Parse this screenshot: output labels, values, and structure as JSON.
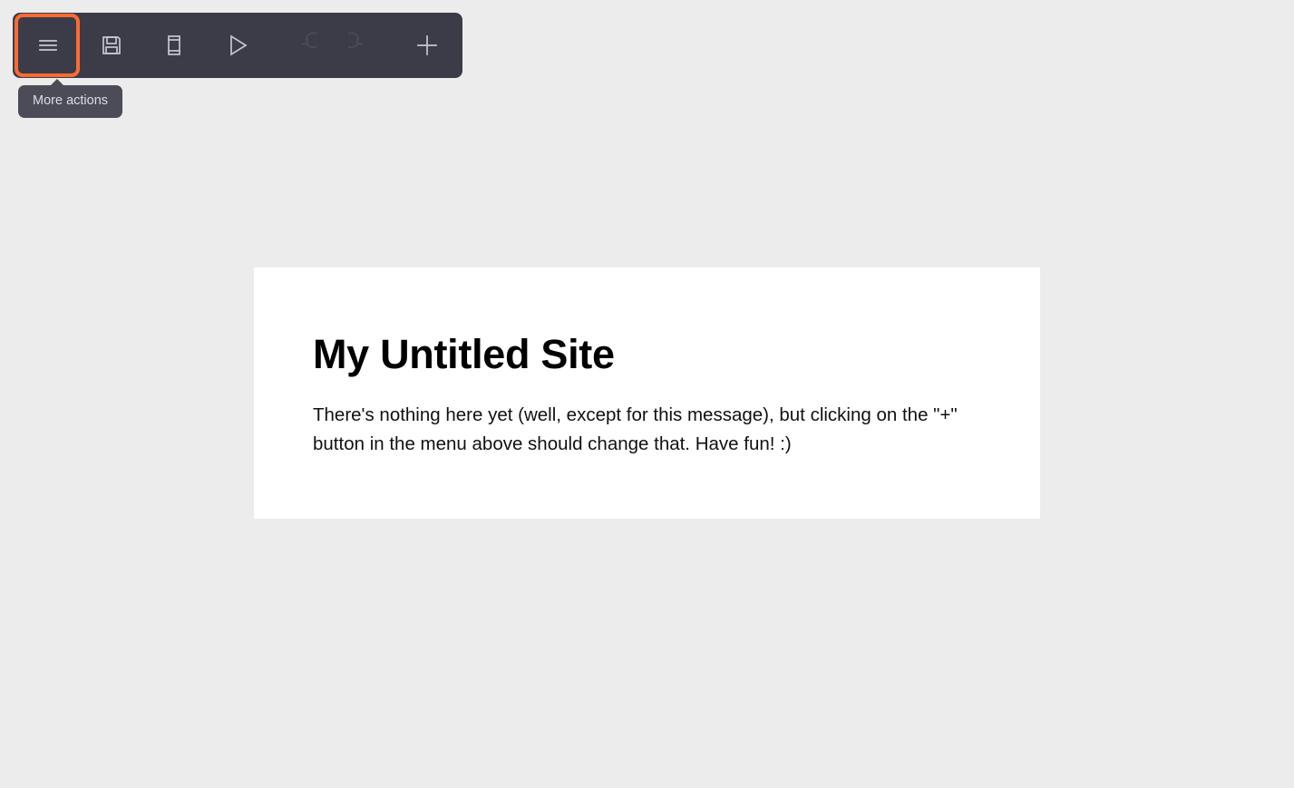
{
  "toolbar": {
    "background_color": "#3b3c48",
    "icon_color": "#c5c7d0",
    "disabled_icon_color": "#4b4c58",
    "buttons": [
      {
        "name": "more-actions",
        "icon": "hamburger-menu-icon",
        "label": "More actions",
        "disabled": false,
        "focused": true
      },
      {
        "name": "save",
        "icon": "floppy-disk-save-icon",
        "label": "Save",
        "disabled": false,
        "focused": false
      },
      {
        "name": "device-preview",
        "icon": "mobile-device-icon",
        "label": "Device preview",
        "disabled": false,
        "focused": false
      },
      {
        "name": "preview",
        "icon": "play-triangle-icon",
        "label": "Preview",
        "disabled": false,
        "focused": false
      },
      {
        "name": "redo",
        "icon": "redo-arrow-icon",
        "label": "Redo",
        "disabled": true,
        "focused": false
      },
      {
        "name": "undo",
        "icon": "undo-arrow-icon",
        "label": "Undo",
        "disabled": true,
        "focused": false
      },
      {
        "name": "add-block",
        "icon": "plus-icon",
        "label": "Add",
        "disabled": false,
        "focused": false
      }
    ]
  },
  "tooltip": {
    "text": "More actions",
    "target": "more-actions",
    "background_color": "#4b4c57",
    "text_color": "#dcdde3"
  },
  "highlight": {
    "color": "#fc6a33",
    "target": "more-actions"
  },
  "canvas": {
    "background_color": "#ffffff",
    "page_background_color": "#ececec",
    "title": "My Untitled Site",
    "body": "There's nothing here yet (well, except for this message), but clicking on the \"+\" button in the menu above should change that. Have fun! :)"
  }
}
